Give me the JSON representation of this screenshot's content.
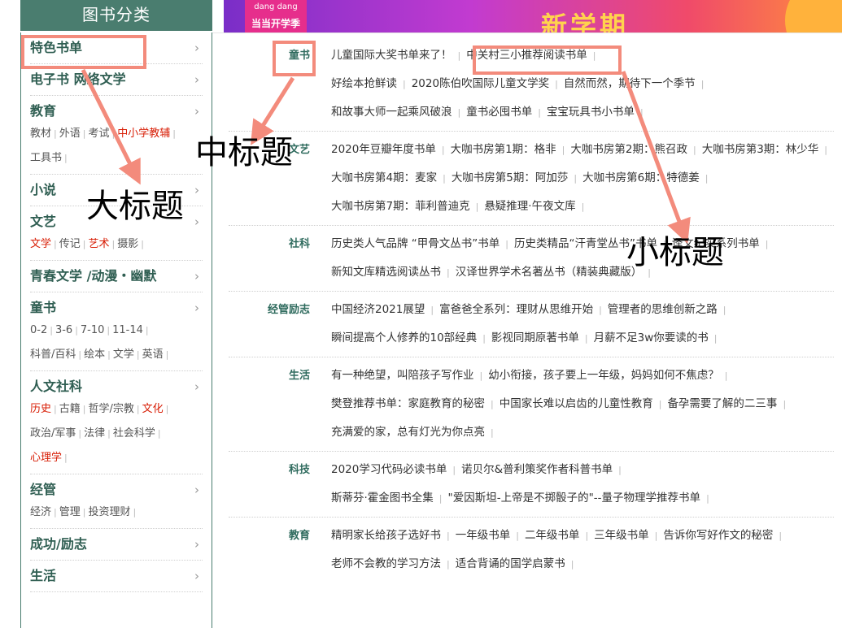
{
  "header": {
    "title": "图书分类"
  },
  "banner": {
    "logo_top": "dang dang",
    "logo_bottom": "当当开学季",
    "headline": "新学期"
  },
  "sidebar": {
    "categories": [
      {
        "title": "特色书单",
        "subs": []
      },
      {
        "title": "电子书 网络文学",
        "subs": []
      },
      {
        "title": "教育",
        "subs": [
          {
            "label": "教材",
            "red": false
          },
          {
            "label": "外语",
            "red": false
          },
          {
            "label": "考试",
            "red": false
          },
          {
            "label": "中小学教辅",
            "red": true
          },
          {
            "label": "工具书",
            "red": false
          }
        ]
      },
      {
        "title": "小说",
        "subs": []
      },
      {
        "title": "文艺",
        "subs": [
          {
            "label": "文学",
            "red": true
          },
          {
            "label": "传记",
            "red": false
          },
          {
            "label": "艺术",
            "red": true
          },
          {
            "label": "摄影",
            "red": false
          }
        ]
      },
      {
        "title": "青春文学 /动漫・幽默",
        "subs": []
      },
      {
        "title": "童书",
        "subs": [
          {
            "label": "0-2",
            "red": false
          },
          {
            "label": "3-6",
            "red": false
          },
          {
            "label": "7-10",
            "red": false
          },
          {
            "label": "11-14",
            "red": false
          },
          {
            "label": "科普/百科",
            "red": false
          },
          {
            "label": "绘本",
            "red": false
          },
          {
            "label": "文学",
            "red": false
          },
          {
            "label": "英语",
            "red": false
          }
        ]
      },
      {
        "title": "人文社科",
        "subs": [
          {
            "label": "历史",
            "red": true
          },
          {
            "label": "古籍",
            "red": false
          },
          {
            "label": "哲学/宗教",
            "red": false
          },
          {
            "label": "文化",
            "red": true
          },
          {
            "label": "政治/军事",
            "red": false
          },
          {
            "label": "法律",
            "red": false
          },
          {
            "label": "社会科学",
            "red": false
          },
          {
            "label": "心理学",
            "red": true
          }
        ]
      },
      {
        "title": "经管",
        "subs": [
          {
            "label": "经济",
            "red": false
          },
          {
            "label": "管理",
            "red": false
          },
          {
            "label": "投资理财",
            "red": false
          }
        ]
      },
      {
        "title": "成功/励志",
        "subs": []
      },
      {
        "title": "生活",
        "subs": []
      }
    ]
  },
  "panel": {
    "groups": [
      {
        "title": "童书",
        "links": [
          "儿童国际大奖书单来了！",
          "中关村三小推荐阅读书单",
          "好绘本抢鲜读",
          "2020陈伯吹国际儿童文学奖",
          "自然而然，期待下一个季节",
          "和故事大师一起乘风破浪",
          "童书必囤书单",
          "宝宝玩具书小书单"
        ]
      },
      {
        "title": "文艺",
        "links": [
          "2020年豆瓣年度书单",
          "大咖书房第1期：格非",
          "大咖书房第2期：熊召政",
          "大咖书房第3期：林少华",
          "大咖书房第4期：麦家",
          "大咖书房第5期：阿加莎",
          "大咖书房第6期：特德姜",
          "大咖书房第7期：菲利普迪克",
          "悬疑推理·午夜文库"
        ]
      },
      {
        "title": "社科",
        "links": [
          "历史类人气品牌 “甲骨文丛书”书单",
          "历史类精品“汗青堂丛书”书单",
          "译文纪实系列书单",
          "新知文库精选阅读丛书",
          "汉译世界学术名著丛书（精装典藏版）"
        ]
      },
      {
        "title": "经管励志",
        "links": [
          "中国经济2021展望",
          "富爸爸全系列：理财从思维开始",
          "管理者的思维创新之路",
          "瞬间提高个人修养的10部经典",
          "影视同期原著书单",
          "月薪不足3w你要读的书"
        ]
      },
      {
        "title": "生活",
        "links": [
          "有一种绝望，叫陪孩子写作业",
          "幼小衔接，孩子要上一年级，妈妈如何不焦虑？",
          "樊登推荐书单：家庭教育的秘密",
          "中国家长难以启齿的儿童性教育",
          "备孕需要了解的二三事",
          "充满爱的家，总有灯光为你点亮"
        ]
      },
      {
        "title": "科技",
        "links": [
          "2020学习代码必读书单",
          "诺贝尔&普利策奖作者科普书单",
          "斯蒂芬·霍金图书全集",
          "\"爱因斯坦-上帝是不掷骰子的\"--量子物理学推荐书单"
        ]
      },
      {
        "title": "教育",
        "links": [
          "精明家长给孩子选好书",
          "一年级书单",
          "二年级书单",
          "三年级书单",
          "告诉你写好作文的秘密",
          "老师不会教的学习方法",
          "适合背诵的国学启蒙书"
        ]
      }
    ]
  },
  "annotations": {
    "big": "大标题",
    "mid": "中标题",
    "small": "小标题",
    "color": "#f38b7c"
  }
}
